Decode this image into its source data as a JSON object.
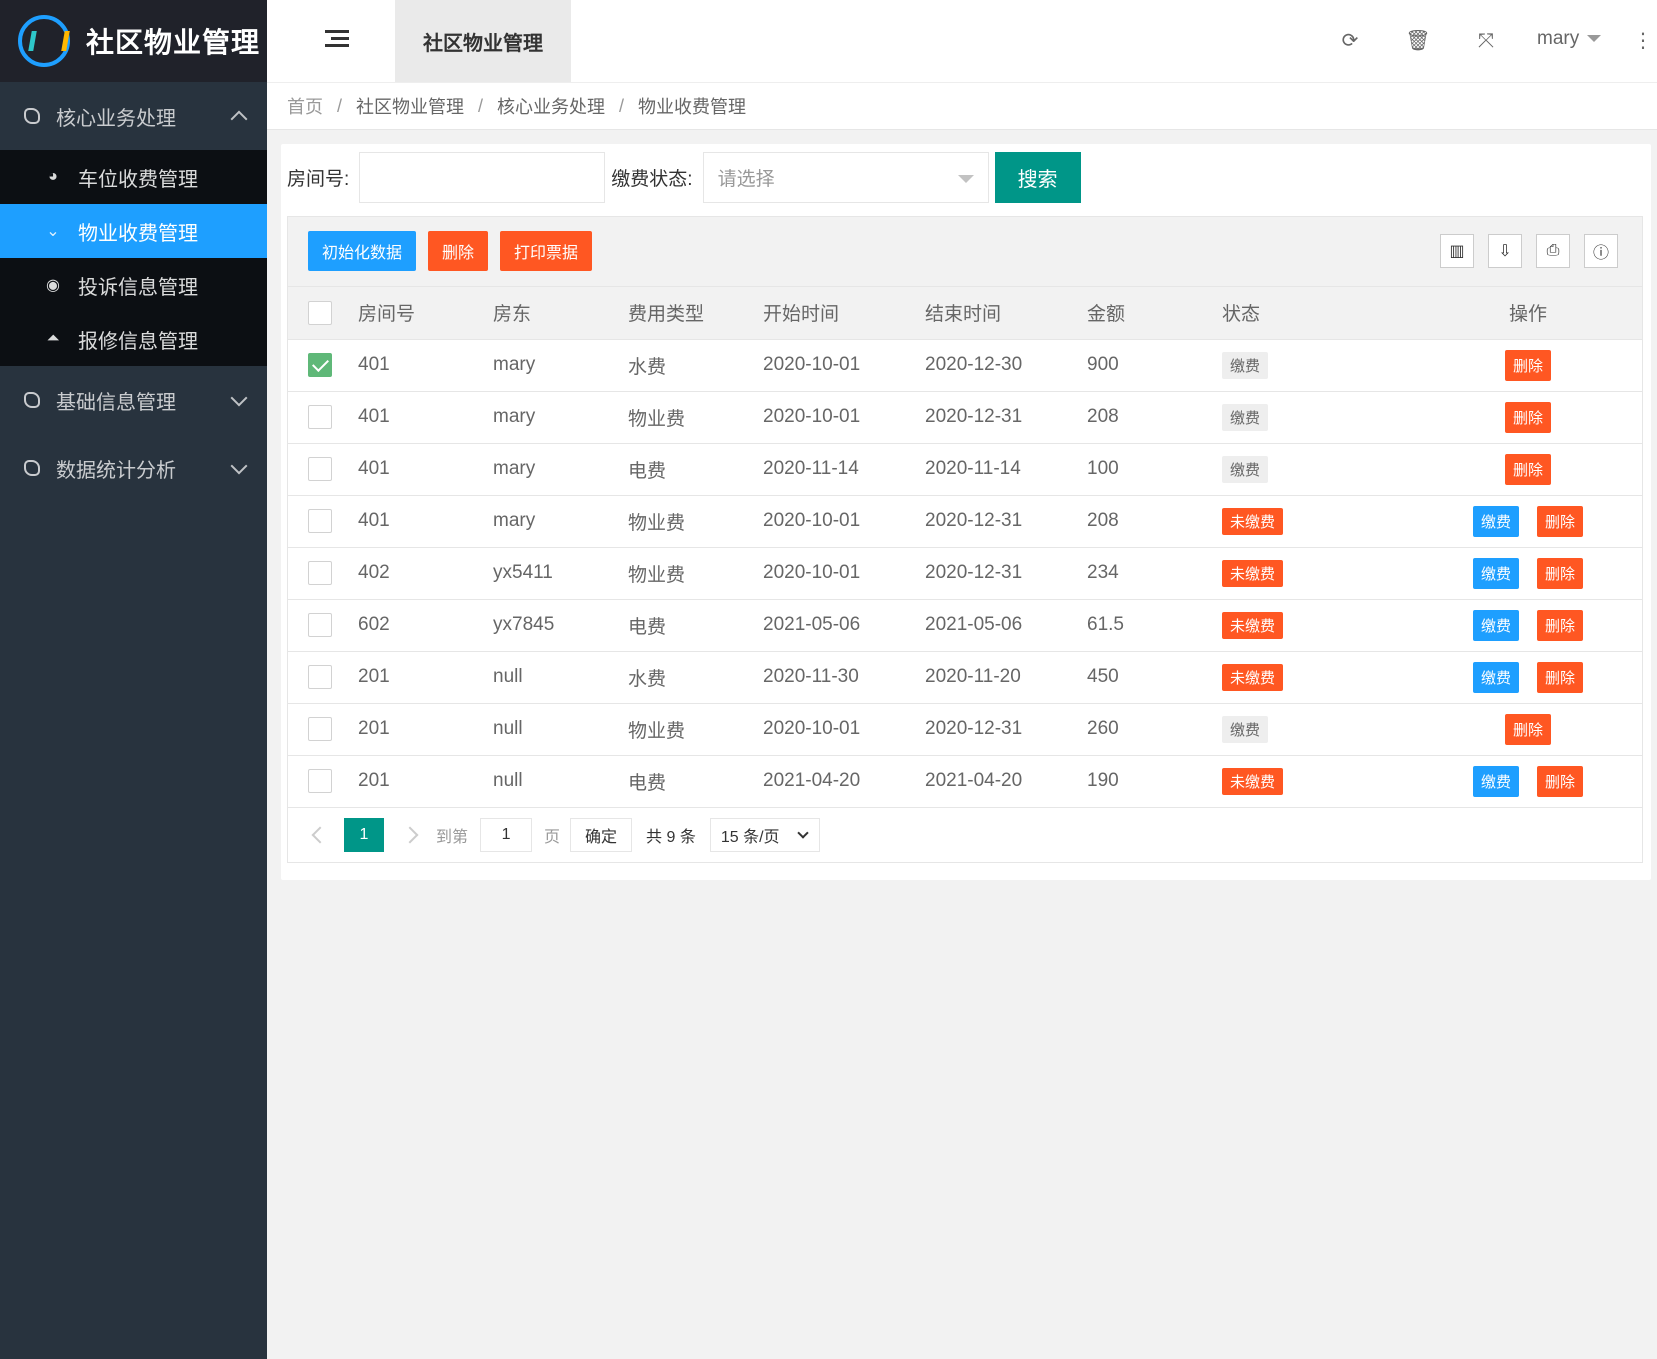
{
  "app": {
    "title": "社区物业管理"
  },
  "sidebar": {
    "groups": [
      {
        "label": "核心业务处理",
        "expanded": true
      },
      {
        "label": "基础信息管理",
        "expanded": false
      },
      {
        "label": "数据统计分析",
        "expanded": false
      }
    ],
    "sub_items": [
      {
        "label": "车位收费管理",
        "icon": "dashboard-icon"
      },
      {
        "label": "物业收费管理",
        "icon": "double-chevron-icon",
        "active": true
      },
      {
        "label": "投诉信息管理",
        "icon": "target-icon"
      },
      {
        "label": "报修信息管理",
        "icon": "up-circle-icon"
      }
    ]
  },
  "header": {
    "tab": "社区物业管理",
    "user": "mary",
    "more": "⋮"
  },
  "breadcrumb": [
    "首页",
    "社区物业管理",
    "核心业务处理",
    "物业收费管理"
  ],
  "search": {
    "room_label": "房间号:",
    "room_value": "",
    "status_label": "缴费状态:",
    "status_placeholder": "请选择",
    "submit": "搜索"
  },
  "toolbar": {
    "init": "初始化数据",
    "delete": "删除",
    "print": "打印票据"
  },
  "table": {
    "headers": [
      "房间号",
      "房东",
      "费用类型",
      "开始时间",
      "结束时间",
      "金额",
      "状态",
      "操作"
    ],
    "pay_label": "缴费",
    "delete_label": "删除",
    "rows": [
      {
        "checked": true,
        "room": "401",
        "owner": "mary",
        "type": "水费",
        "start": "2020-10-01",
        "end": "2020-12-30",
        "amount": "900",
        "status": "缴费",
        "paid": true
      },
      {
        "checked": false,
        "room": "401",
        "owner": "mary",
        "type": "物业费",
        "start": "2020-10-01",
        "end": "2020-12-31",
        "amount": "208",
        "status": "缴费",
        "paid": true
      },
      {
        "checked": false,
        "room": "401",
        "owner": "mary",
        "type": "电费",
        "start": "2020-11-14",
        "end": "2020-11-14",
        "amount": "100",
        "status": "缴费",
        "paid": true
      },
      {
        "checked": false,
        "room": "401",
        "owner": "mary",
        "type": "物业费",
        "start": "2020-10-01",
        "end": "2020-12-31",
        "amount": "208",
        "status": "未缴费",
        "paid": false
      },
      {
        "checked": false,
        "room": "402",
        "owner": "yx5411",
        "type": "物业费",
        "start": "2020-10-01",
        "end": "2020-12-31",
        "amount": "234",
        "status": "未缴费",
        "paid": false
      },
      {
        "checked": false,
        "room": "602",
        "owner": "yx7845",
        "type": "电费",
        "start": "2021-05-06",
        "end": "2021-05-06",
        "amount": "61.5",
        "status": "未缴费",
        "paid": false
      },
      {
        "checked": false,
        "room": "201",
        "owner": "null",
        "type": "水费",
        "start": "2020-11-30",
        "end": "2020-11-20",
        "amount": "450",
        "status": "未缴费",
        "paid": false
      },
      {
        "checked": false,
        "room": "201",
        "owner": "null",
        "type": "物业费",
        "start": "2020-10-01",
        "end": "2020-12-31",
        "amount": "260",
        "status": "缴费",
        "paid": true
      },
      {
        "checked": false,
        "room": "201",
        "owner": "null",
        "type": "电费",
        "start": "2021-04-20",
        "end": "2021-04-20",
        "amount": "190",
        "status": "未缴费",
        "paid": false
      }
    ]
  },
  "pager": {
    "current": "1",
    "goto_label": "到第",
    "goto_value": "1",
    "page_label": "页",
    "confirm": "确定",
    "total": "共 9 条",
    "page_size": "15 条/页"
  },
  "colors": {
    "primary": "#009688",
    "blue": "#1e9fff",
    "danger": "#ff5722",
    "sidebar": "#28333e"
  }
}
